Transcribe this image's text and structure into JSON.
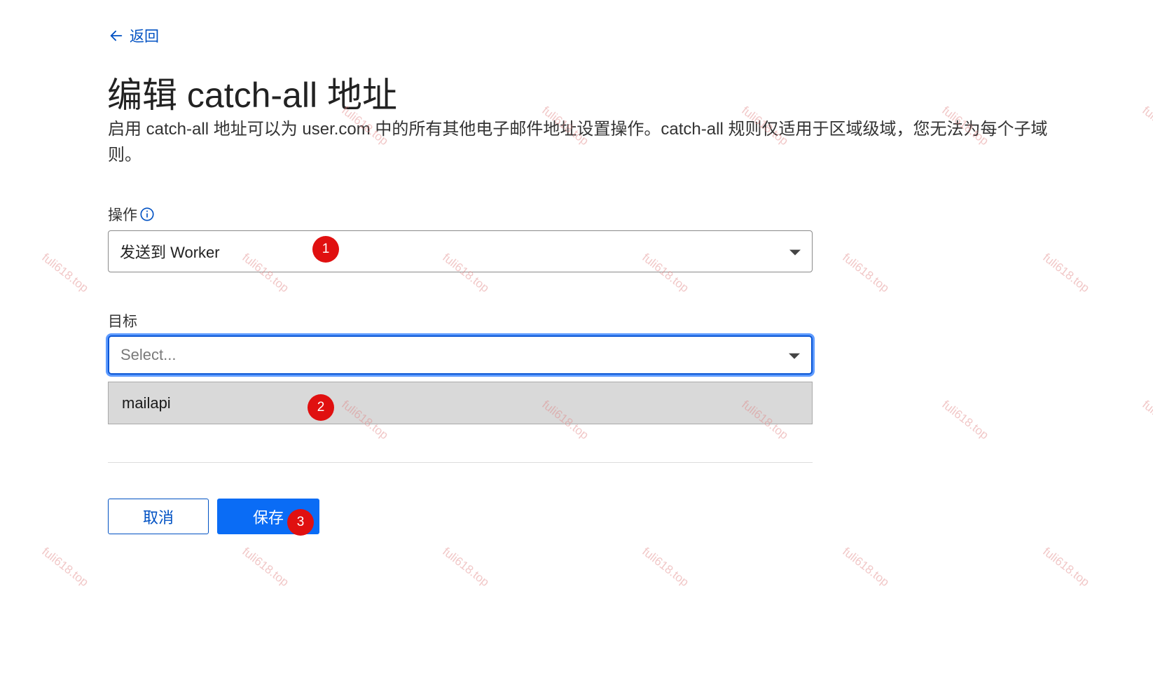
{
  "back": {
    "label": "返回",
    "icon": "arrow-left-icon"
  },
  "title": "编辑 catch-all 地址",
  "description": "启用 catch-all 地址可以为 user.com 中的所有其他电子邮件地址设置操作。catch-all 规则仅适用于区域级域，您无法为每个子域\n则。",
  "action_field": {
    "label": "操作",
    "value": "发送到 Worker",
    "info_icon": "info-icon"
  },
  "target_field": {
    "label": "目标",
    "placeholder": "Select..."
  },
  "dropdown": {
    "options": [
      "mailapi"
    ]
  },
  "buttons": {
    "cancel": "取消",
    "save": "保存"
  },
  "step_badges": [
    "1",
    "2",
    "3"
  ],
  "watermark": "fuli618.top",
  "colors": {
    "link": "#0051c3",
    "primary": "#0a6cf5",
    "focus_ring": "#5e9bff",
    "badge": "#e01010",
    "option_bg": "#d9d9d9"
  }
}
